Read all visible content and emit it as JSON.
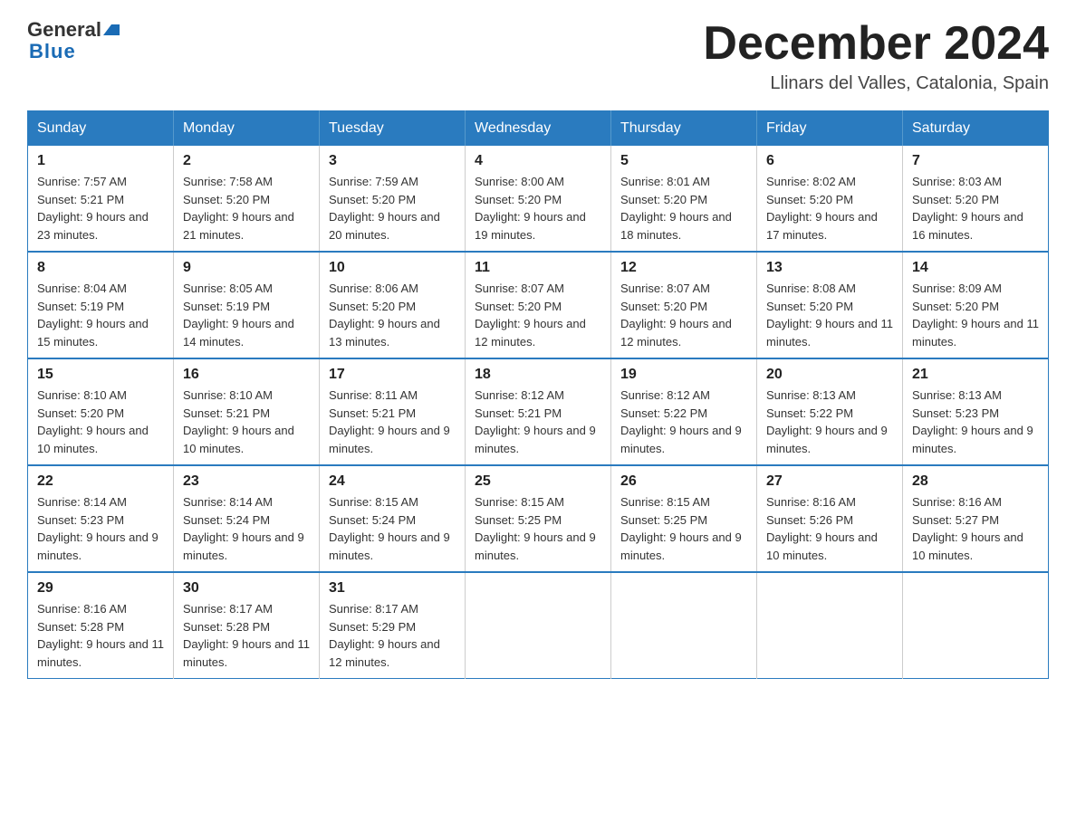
{
  "logo": {
    "general": "General",
    "blue": "Blue"
  },
  "title": "December 2024",
  "subtitle": "Llinars del Valles, Catalonia, Spain",
  "days_of_week": [
    "Sunday",
    "Monday",
    "Tuesday",
    "Wednesday",
    "Thursday",
    "Friday",
    "Saturday"
  ],
  "weeks": [
    [
      {
        "day": "1",
        "sunrise": "7:57 AM",
        "sunset": "5:21 PM",
        "daylight": "9 hours and 23 minutes."
      },
      {
        "day": "2",
        "sunrise": "7:58 AM",
        "sunset": "5:20 PM",
        "daylight": "9 hours and 21 minutes."
      },
      {
        "day": "3",
        "sunrise": "7:59 AM",
        "sunset": "5:20 PM",
        "daylight": "9 hours and 20 minutes."
      },
      {
        "day": "4",
        "sunrise": "8:00 AM",
        "sunset": "5:20 PM",
        "daylight": "9 hours and 19 minutes."
      },
      {
        "day": "5",
        "sunrise": "8:01 AM",
        "sunset": "5:20 PM",
        "daylight": "9 hours and 18 minutes."
      },
      {
        "day": "6",
        "sunrise": "8:02 AM",
        "sunset": "5:20 PM",
        "daylight": "9 hours and 17 minutes."
      },
      {
        "day": "7",
        "sunrise": "8:03 AM",
        "sunset": "5:20 PM",
        "daylight": "9 hours and 16 minutes."
      }
    ],
    [
      {
        "day": "8",
        "sunrise": "8:04 AM",
        "sunset": "5:19 PM",
        "daylight": "9 hours and 15 minutes."
      },
      {
        "day": "9",
        "sunrise": "8:05 AM",
        "sunset": "5:19 PM",
        "daylight": "9 hours and 14 minutes."
      },
      {
        "day": "10",
        "sunrise": "8:06 AM",
        "sunset": "5:20 PM",
        "daylight": "9 hours and 13 minutes."
      },
      {
        "day": "11",
        "sunrise": "8:07 AM",
        "sunset": "5:20 PM",
        "daylight": "9 hours and 12 minutes."
      },
      {
        "day": "12",
        "sunrise": "8:07 AM",
        "sunset": "5:20 PM",
        "daylight": "9 hours and 12 minutes."
      },
      {
        "day": "13",
        "sunrise": "8:08 AM",
        "sunset": "5:20 PM",
        "daylight": "9 hours and 11 minutes."
      },
      {
        "day": "14",
        "sunrise": "8:09 AM",
        "sunset": "5:20 PM",
        "daylight": "9 hours and 11 minutes."
      }
    ],
    [
      {
        "day": "15",
        "sunrise": "8:10 AM",
        "sunset": "5:20 PM",
        "daylight": "9 hours and 10 minutes."
      },
      {
        "day": "16",
        "sunrise": "8:10 AM",
        "sunset": "5:21 PM",
        "daylight": "9 hours and 10 minutes."
      },
      {
        "day": "17",
        "sunrise": "8:11 AM",
        "sunset": "5:21 PM",
        "daylight": "9 hours and 9 minutes."
      },
      {
        "day": "18",
        "sunrise": "8:12 AM",
        "sunset": "5:21 PM",
        "daylight": "9 hours and 9 minutes."
      },
      {
        "day": "19",
        "sunrise": "8:12 AM",
        "sunset": "5:22 PM",
        "daylight": "9 hours and 9 minutes."
      },
      {
        "day": "20",
        "sunrise": "8:13 AM",
        "sunset": "5:22 PM",
        "daylight": "9 hours and 9 minutes."
      },
      {
        "day": "21",
        "sunrise": "8:13 AM",
        "sunset": "5:23 PM",
        "daylight": "9 hours and 9 minutes."
      }
    ],
    [
      {
        "day": "22",
        "sunrise": "8:14 AM",
        "sunset": "5:23 PM",
        "daylight": "9 hours and 9 minutes."
      },
      {
        "day": "23",
        "sunrise": "8:14 AM",
        "sunset": "5:24 PM",
        "daylight": "9 hours and 9 minutes."
      },
      {
        "day": "24",
        "sunrise": "8:15 AM",
        "sunset": "5:24 PM",
        "daylight": "9 hours and 9 minutes."
      },
      {
        "day": "25",
        "sunrise": "8:15 AM",
        "sunset": "5:25 PM",
        "daylight": "9 hours and 9 minutes."
      },
      {
        "day": "26",
        "sunrise": "8:15 AM",
        "sunset": "5:25 PM",
        "daylight": "9 hours and 9 minutes."
      },
      {
        "day": "27",
        "sunrise": "8:16 AM",
        "sunset": "5:26 PM",
        "daylight": "9 hours and 10 minutes."
      },
      {
        "day": "28",
        "sunrise": "8:16 AM",
        "sunset": "5:27 PM",
        "daylight": "9 hours and 10 minutes."
      }
    ],
    [
      {
        "day": "29",
        "sunrise": "8:16 AM",
        "sunset": "5:28 PM",
        "daylight": "9 hours and 11 minutes."
      },
      {
        "day": "30",
        "sunrise": "8:17 AM",
        "sunset": "5:28 PM",
        "daylight": "9 hours and 11 minutes."
      },
      {
        "day": "31",
        "sunrise": "8:17 AM",
        "sunset": "5:29 PM",
        "daylight": "9 hours and 12 minutes."
      },
      null,
      null,
      null,
      null
    ]
  ]
}
